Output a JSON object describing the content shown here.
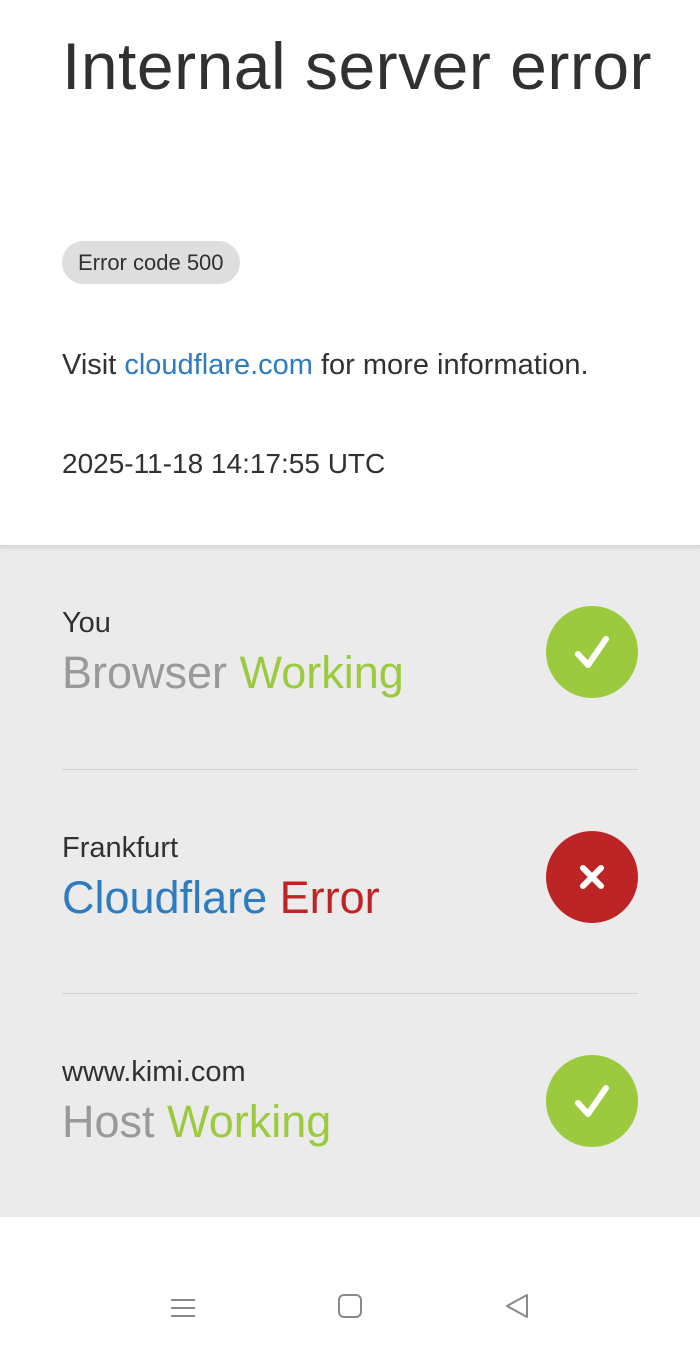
{
  "page": {
    "title": "Internal server error",
    "error_code": "Error code 500",
    "visit_prefix": "Visit",
    "visit_link": "cloudflare.com",
    "visit_suffix": "for more information.",
    "timestamp": "2025-11-18 14:17:55 UTC"
  },
  "status": [
    {
      "location": "You",
      "service": "Browser",
      "state": "Working",
      "icon": "checkmark-icon",
      "color": "#9bca3e"
    },
    {
      "location": "Frankfurt",
      "service": "Cloudflare",
      "state": "Error",
      "icon": "close-icon",
      "color": "#bd2426"
    },
    {
      "location": "www.kimi.com",
      "service": "Host",
      "state": "Working",
      "icon": "checkmark-icon",
      "color": "#9bca3e"
    }
  ],
  "nav": {
    "icons": [
      "menu-icon",
      "home-icon",
      "back-icon"
    ]
  },
  "colors": {
    "link_blue": "#2f7bbf",
    "ok_green": "#9bca3e",
    "error_red": "#bd2426",
    "panel_gray": "#ebebeb"
  }
}
